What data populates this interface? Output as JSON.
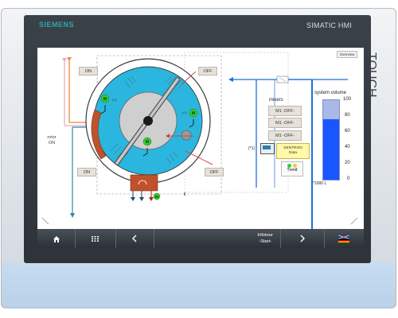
{
  "brand": "SIEMENS",
  "product": "SIMATIC HMI",
  "touch_label": "TOUCH",
  "colors": {
    "rotor_fill": "#2ab6de",
    "hub_fill": "#cfcfcf",
    "flow_blue": "#1e6fe0",
    "tank_fill": "#1a56ff",
    "tank_empty": "#a9b8e6",
    "status_green": "#37c837",
    "brake_orange": "#c0522b",
    "drain_teal": "#2a8aa8"
  },
  "overview_button": "Overview",
  "process": {
    "rotor_label_line1": "rotor",
    "rotor_label_line2": "ON",
    "on_top": "ON",
    "on_bottom": "ON",
    "off_top": "OFF",
    "off_bottom": "OFF",
    "motor_tags": [
      "M",
      "M",
      "M",
      "M"
    ],
    "motor_tag_suffix": "(*1)",
    "motor_tag_suffix2": "(*1)"
  },
  "mixers": {
    "title": "mixers",
    "items": [
      "M1 -OFF-",
      "M1 -OFF-",
      "M1 -OFF-"
    ]
  },
  "sentron": {
    "ref": "(*1)",
    "line1": "SENTRON",
    "line2": "Data"
  },
  "trend": {
    "label": "Trend"
  },
  "volume": {
    "title": "system volume",
    "ticks": [
      "100",
      "80",
      "60",
      "40",
      "20",
      "0"
    ],
    "unit": "*1000 L",
    "level_fraction": 0.76
  },
  "taskbar": {
    "info_line1": "Infotour",
    "info_line2": "-Start-",
    "buttons": [
      "home-icon",
      "keypad-icon",
      "previous-icon",
      "next-icon",
      "language-flag-icon"
    ]
  }
}
